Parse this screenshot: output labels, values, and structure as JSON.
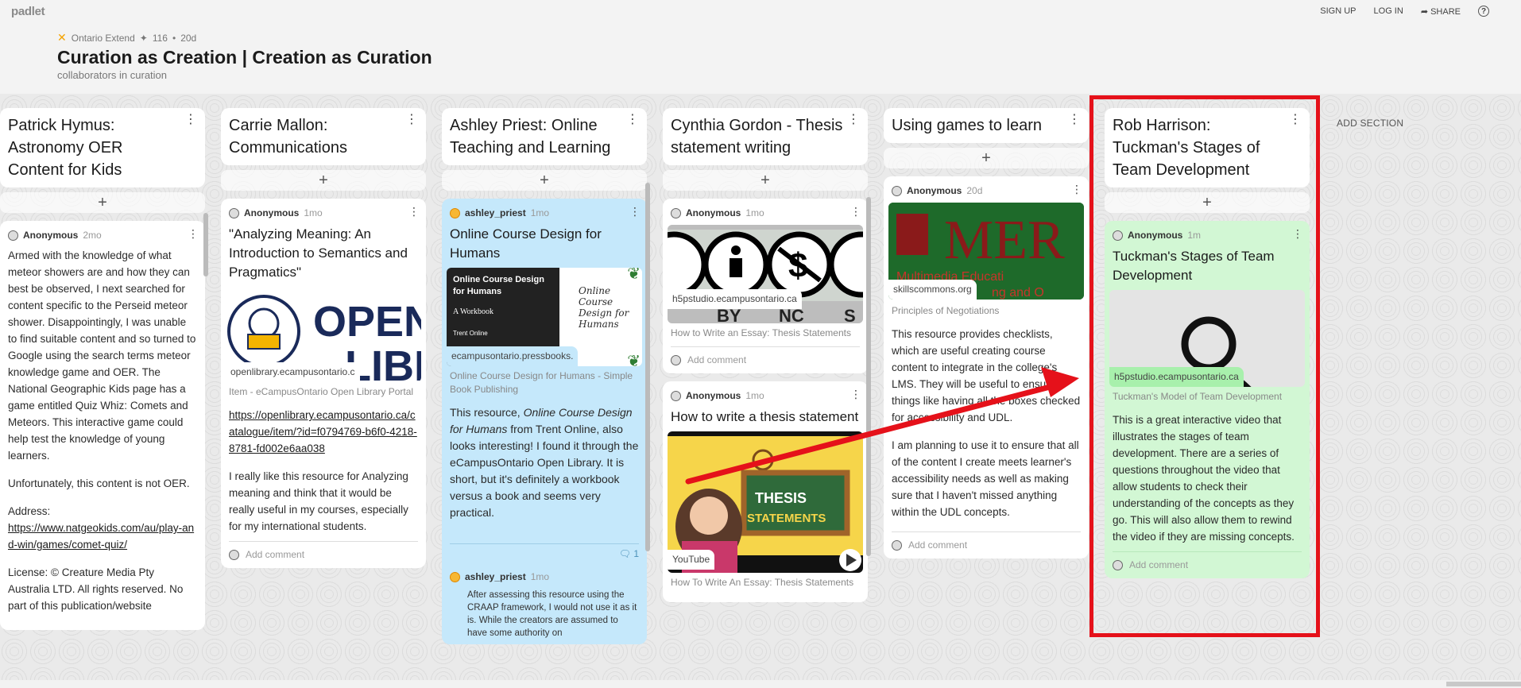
{
  "app": {
    "logo": "padlet"
  },
  "nav": {
    "signup": "SIGN UP",
    "login": "LOG IN",
    "share": "SHARE"
  },
  "header": {
    "org": "Ontario Extend",
    "likes": "116",
    "age": "20d",
    "title": "Curation as Creation | Creation as Curation",
    "subtitle": "collaborators in curation"
  },
  "add_section": "ADD SECTION",
  "columns": [
    {
      "title": "Patrick Hymus: Astronomy OER Content for Kids",
      "card": {
        "author": "Anonymous",
        "ago": "2mo",
        "p1": "Armed with the knowledge of what meteor showers are and how they can best be observed, I next searched for content specific to the Perseid meteor shower. Disappointingly, I was unable to find suitable content and so turned to Google using the search terms meteor knowledge game and OER. The National Geographic Kids page has a game entitled Quiz Whiz: Comets and Meteors. This interactive game could help test the knowledge of young learners.",
        "p2": "Unfortunately, this content is not OER.",
        "p3_label": "Address:",
        "p3_link": "https://www.natgeokids.com/au/play-and-win/games/comet-quiz/",
        "p4": "License: © Creature Media Pty Australia LTD. All rights reserved. No part of this publication/website"
      }
    },
    {
      "title": "Carrie Mallon: Communications",
      "card": {
        "author": "Anonymous",
        "ago": "1mo",
        "title": "\"Analyzing Meaning: An Introduction to Semantics and Pragmatics\"",
        "thumb_text": "OPEN LIBR",
        "source": "openlibrary.ecampusontario.c",
        "caption": "Item - eCampusOntario Open Library Portal",
        "link": "https://openlibrary.ecampusontario.ca/catalogue/item/?id=f0794769-b6f0-4218-8781-fd002e6aa038",
        "body": "I really like this resource for Analyzing meaning and think that it would be really useful in my courses, especially for my international students.",
        "add_comment": "Add comment"
      }
    },
    {
      "title": "Ashley Priest: Online Teaching and Learning",
      "card": {
        "author": "ashley_priest",
        "ago": "1mo",
        "title": "Online Course Design for Humans",
        "thumb_title": "Online Course Design for Humans",
        "thumb_sub": "A Workbook",
        "thumb_credit": "Trent Online",
        "thumb_script": "Online Course Design for Humans",
        "source": "ecampusontario.pressbooks.",
        "caption": "Online Course Design for Humans - Simple Book Publishing",
        "body_a": "This resource, ",
        "body_em": "Online Course Design for Humans",
        "body_b": " from Trent Online, also looks interesting! I found it through the eCampusOntario Open Library. It is short, but it's definitely a workbook versus a book and seems very practical.",
        "comments": "1"
      },
      "comment": {
        "author": "ashley_priest",
        "ago": "1mo",
        "text": "After assessing this resource using the CRAAP framework, I would not use it as it is. While the creators are assumed to have some authority on"
      }
    },
    {
      "title": "Cynthia Gordon - Thesis statement writing",
      "card1": {
        "author": "Anonymous",
        "ago": "1mo",
        "source": "h5pstudio.ecampusontario.ca",
        "caption": "How to Write an Essay: Thesis Statements",
        "add_comment": "Add comment"
      },
      "card2": {
        "author": "Anonymous",
        "ago": "1mo",
        "title": "How to write a thesis statement",
        "thumb_text": "THESIS STATEMENTS",
        "source": "YouTube",
        "caption": "How To Write An Essay: Thesis Statements"
      }
    },
    {
      "title": "Using games to learn",
      "card": {
        "author": "Anonymous",
        "ago": "20d",
        "thumb_big": "MER",
        "thumb_sub": "Multimedia Educati",
        "thumb_sub2": "ng and O",
        "source": "skillscommons.org",
        "caption": "Principles of Negotiations",
        "p1": "This resource provides checklists, which are useful creating course content to integrate in the college's LMS. They will be useful to ensure things like having all the boxes checked for accessibility and UDL.",
        "p2": "I am planning to use it to ensure that all of the content I create meets learner's accessibility needs as well as making sure that I haven't missed anything within the UDL concepts.",
        "add_comment": "Add comment"
      }
    },
    {
      "title": "Rob Harrison: Tuckman's Stages of Team Development",
      "card": {
        "author": "Anonymous",
        "ago": "1m",
        "title": "Tuckman's Stages of Team Development",
        "source": "h5pstudio.ecampusontario.ca",
        "caption": "Tuckman's Model of Team Development",
        "body": "This is a great interactive video that illustrates the stages of team development. There are a series of questions throughout the video that allow students to check their understanding of the concepts as they go. This will also allow them to rewind the video if they are missing concepts.",
        "add_comment": "Add comment"
      }
    }
  ],
  "colors": {
    "highlight": "#e5111a",
    "blue_card": "#c5e8fb",
    "green_card": "#d2f7d4"
  }
}
